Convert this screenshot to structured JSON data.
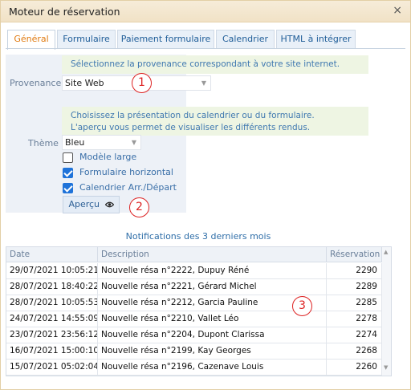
{
  "window": {
    "title": "Moteur de réservation",
    "close": "×"
  },
  "tabs": [
    {
      "label": "Général",
      "active": true
    },
    {
      "label": "Formulaire"
    },
    {
      "label": "Paiement formulaire"
    },
    {
      "label": "Calendrier"
    },
    {
      "label": "HTML à intégrer"
    }
  ],
  "provenance": {
    "help": "Sélectionnez la provenance correspondant à votre site internet.",
    "label": "Provenance",
    "value": "Site Web"
  },
  "theme": {
    "help_line1": "Choisissez la présentation du calendrier ou du formulaire.",
    "help_line2": "L'aperçu vous permet de visualiser les différents rendus.",
    "label": "Thème",
    "value": "Bleu"
  },
  "options": {
    "modele_large": {
      "label": "Modèle large",
      "checked": false
    },
    "formulaire_horizontal": {
      "label": "Formulaire horizontal",
      "checked": true
    },
    "calendrier_arr_depart": {
      "label": "Calendrier Arr./Départ",
      "checked": true
    }
  },
  "apercu_button": {
    "label": "Aperçu",
    "icon": "eye-icon"
  },
  "markers": [
    "1",
    "2",
    "3"
  ],
  "notifications": {
    "title": "Notifications des 3 derniers mois",
    "columns": [
      "Date",
      "Description",
      "Réservation"
    ],
    "rows": [
      {
        "date": "29/07/2021 10:05:21",
        "description": "Nouvelle résa n°2222, Dupuy Réné",
        "reservation": "2290"
      },
      {
        "date": "28/07/2021 18:40:22",
        "description": "Nouvelle résa n°2221, Gérard Michel",
        "reservation": "2289"
      },
      {
        "date": "28/07/2021 10:05:53",
        "description": "Nouvelle résa n°2212, Garcia Pauline",
        "reservation": "2285"
      },
      {
        "date": "24/07/2021 14:55:09",
        "description": "Nouvelle résa n°2210, Vallet Léo",
        "reservation": "2278"
      },
      {
        "date": "23/07/2021 23:56:12",
        "description": "Nouvelle résa n°2204, Dupont Clarissa",
        "reservation": "2274"
      },
      {
        "date": "16/07/2021 15:00:10",
        "description": "Nouvelle résa n°2199, Kay Georges",
        "reservation": "2268"
      },
      {
        "date": "15/07/2021 05:02:04",
        "description": "Nouvelle résa n°2196, Cazenave Louis",
        "reservation": "2260"
      }
    ]
  },
  "colors": {
    "accent_tab": "#e07a10",
    "link_blue": "#2f6ea8",
    "marker_red": "#dd2222",
    "checkbox_blue": "#1f73d9"
  }
}
